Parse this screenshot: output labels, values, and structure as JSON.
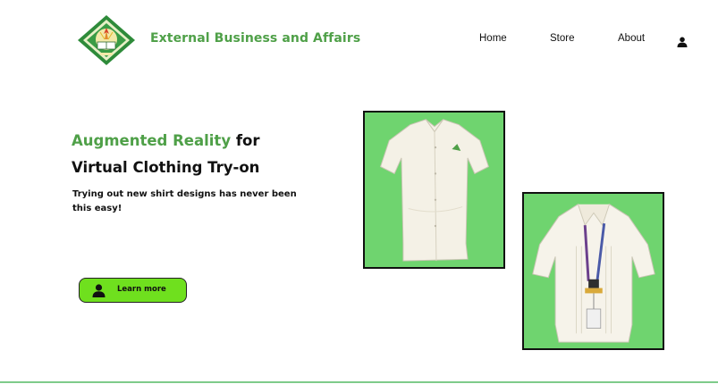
{
  "header": {
    "brand": "External Business and Affairs",
    "logo_icon": "university-seal-icon",
    "nav": [
      {
        "label": "Home"
      },
      {
        "label": "Store"
      },
      {
        "label": "About"
      }
    ],
    "account_icon": "user-icon"
  },
  "hero": {
    "title_accent": "Augmented Reality",
    "title_rest": " for",
    "title_line2": "Virtual Clothing Try-on",
    "subtitle": "Trying out new shirt designs has never been this easy!",
    "cta": {
      "label": "Learn more",
      "icon": "user-icon"
    }
  },
  "gallery": [
    {
      "name": "white-polo-shirt"
    },
    {
      "name": "white-blouse-with-lanyard"
    }
  ],
  "colors": {
    "accent": "#4fa048",
    "cta_background": "#6fe01e",
    "photo_background": "#6fd46f",
    "divider": "#7ecb8a"
  }
}
